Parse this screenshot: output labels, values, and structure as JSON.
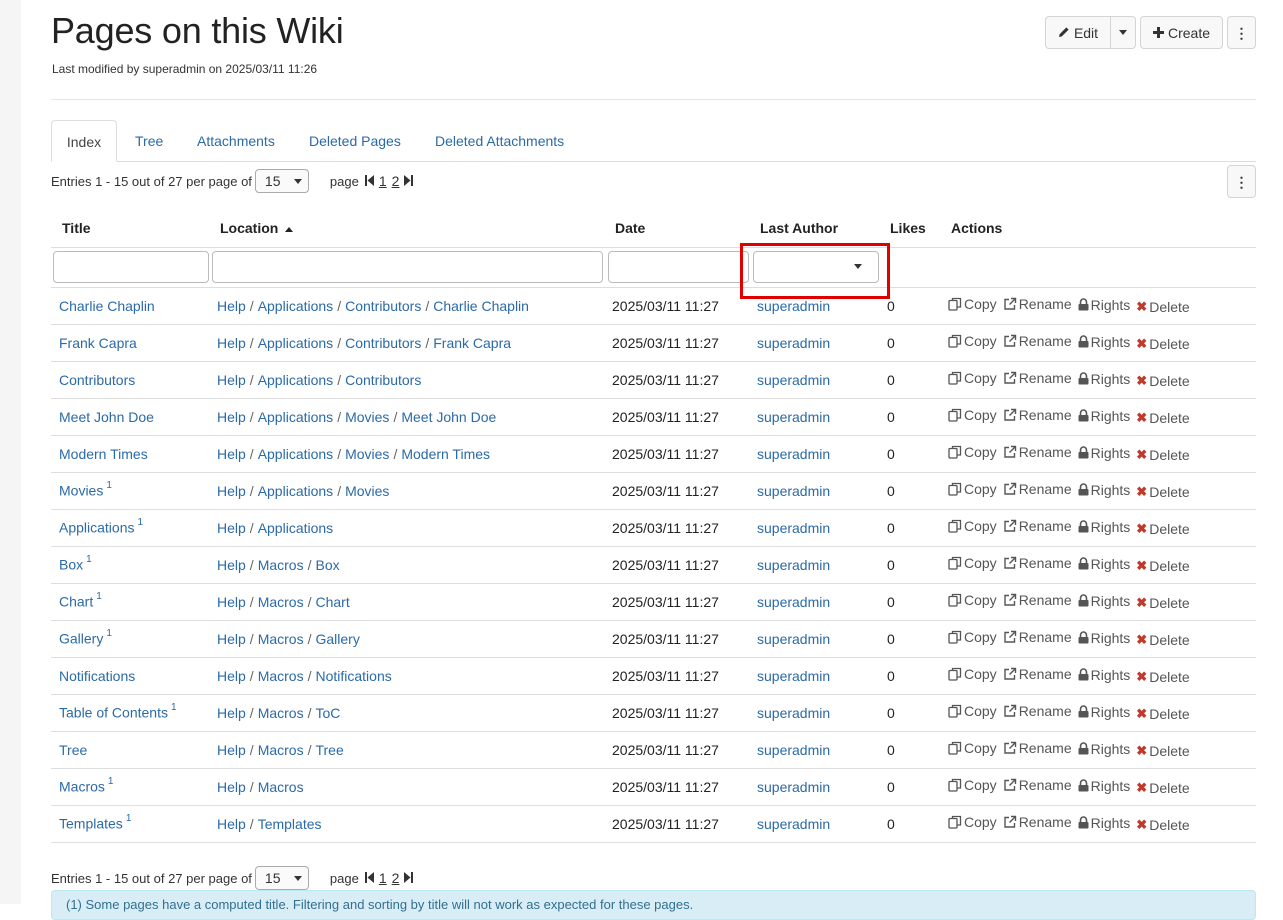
{
  "page": {
    "title": "Pages on this Wiki",
    "last_modified": "Last modified by superadmin on 2025/03/11 11:26"
  },
  "toolbar": {
    "edit_label": "Edit",
    "create_label": "Create"
  },
  "tabs": [
    {
      "label": "Index",
      "active": true
    },
    {
      "label": "Tree",
      "active": false
    },
    {
      "label": "Attachments",
      "active": false
    },
    {
      "label": "Deleted Pages",
      "active": false
    },
    {
      "label": "Deleted Attachments",
      "active": false
    }
  ],
  "pagination": {
    "entries_text": "Entries 1 - 15 out of 27 per page of",
    "per_page": "15",
    "page_label": "page",
    "pages": [
      "1",
      "2"
    ]
  },
  "table": {
    "columns": {
      "title": "Title",
      "location": "Location",
      "date": "Date",
      "last_author": "Last Author",
      "likes": "Likes",
      "actions": "Actions"
    },
    "action_labels": {
      "copy": "Copy",
      "rename": "Rename",
      "rights": "Rights",
      "delete": "Delete"
    },
    "rows": [
      {
        "title": "Charlie Chaplin",
        "sup": "",
        "location": [
          "Help",
          "Applications",
          "Contributors",
          "Charlie Chaplin"
        ],
        "date": "2025/03/11 11:27",
        "author": "superadmin",
        "likes": "0"
      },
      {
        "title": "Frank Capra",
        "sup": "",
        "location": [
          "Help",
          "Applications",
          "Contributors",
          "Frank Capra"
        ],
        "date": "2025/03/11 11:27",
        "author": "superadmin",
        "likes": "0"
      },
      {
        "title": "Contributors",
        "sup": "",
        "location": [
          "Help",
          "Applications",
          "Contributors"
        ],
        "date": "2025/03/11 11:27",
        "author": "superadmin",
        "likes": "0"
      },
      {
        "title": "Meet John Doe",
        "sup": "",
        "location": [
          "Help",
          "Applications",
          "Movies",
          "Meet John Doe"
        ],
        "date": "2025/03/11 11:27",
        "author": "superadmin",
        "likes": "0"
      },
      {
        "title": "Modern Times",
        "sup": "",
        "location": [
          "Help",
          "Applications",
          "Movies",
          "Modern Times"
        ],
        "date": "2025/03/11 11:27",
        "author": "superadmin",
        "likes": "0"
      },
      {
        "title": "Movies",
        "sup": "1",
        "location": [
          "Help",
          "Applications",
          "Movies"
        ],
        "date": "2025/03/11 11:27",
        "author": "superadmin",
        "likes": "0"
      },
      {
        "title": "Applications",
        "sup": "1",
        "location": [
          "Help",
          "Applications"
        ],
        "date": "2025/03/11 11:27",
        "author": "superadmin",
        "likes": "0"
      },
      {
        "title": "Box",
        "sup": "1",
        "location": [
          "Help",
          "Macros",
          "Box"
        ],
        "date": "2025/03/11 11:27",
        "author": "superadmin",
        "likes": "0"
      },
      {
        "title": "Chart",
        "sup": "1",
        "location": [
          "Help",
          "Macros",
          "Chart"
        ],
        "date": "2025/03/11 11:27",
        "author": "superadmin",
        "likes": "0"
      },
      {
        "title": "Gallery",
        "sup": "1",
        "location": [
          "Help",
          "Macros",
          "Gallery"
        ],
        "date": "2025/03/11 11:27",
        "author": "superadmin",
        "likes": "0"
      },
      {
        "title": "Notifications",
        "sup": "",
        "location": [
          "Help",
          "Macros",
          "Notifications"
        ],
        "date": "2025/03/11 11:27",
        "author": "superadmin",
        "likes": "0"
      },
      {
        "title": "Table of Contents",
        "sup": "1",
        "location": [
          "Help",
          "Macros",
          "ToC"
        ],
        "date": "2025/03/11 11:27",
        "author": "superadmin",
        "likes": "0"
      },
      {
        "title": "Tree",
        "sup": "",
        "location": [
          "Help",
          "Macros",
          "Tree"
        ],
        "date": "2025/03/11 11:27",
        "author": "superadmin",
        "likes": "0"
      },
      {
        "title": "Macros",
        "sup": "1",
        "location": [
          "Help",
          "Macros"
        ],
        "date": "2025/03/11 11:27",
        "author": "superadmin",
        "likes": "0"
      },
      {
        "title": "Templates",
        "sup": "1",
        "location": [
          "Help",
          "Templates"
        ],
        "date": "2025/03/11 11:27",
        "author": "superadmin",
        "likes": "0"
      }
    ]
  },
  "footnote": "(1) Some pages have a computed title. Filtering and sorting by title will not work as expected for these pages.",
  "colors": {
    "link": "#2b6aa8",
    "delete_icon": "#c0392b",
    "highlight_box": "#e00000",
    "alert_bg": "#d9edf7"
  },
  "icons": {
    "edit": "pencil-icon",
    "create": "plus-icon",
    "more": "vertical-dots-icon",
    "copy": "copy-icon",
    "rename": "external-link-icon",
    "rights": "lock-icon",
    "delete": "x-icon",
    "first_page": "first-page-icon",
    "last_page": "last-page-icon"
  }
}
